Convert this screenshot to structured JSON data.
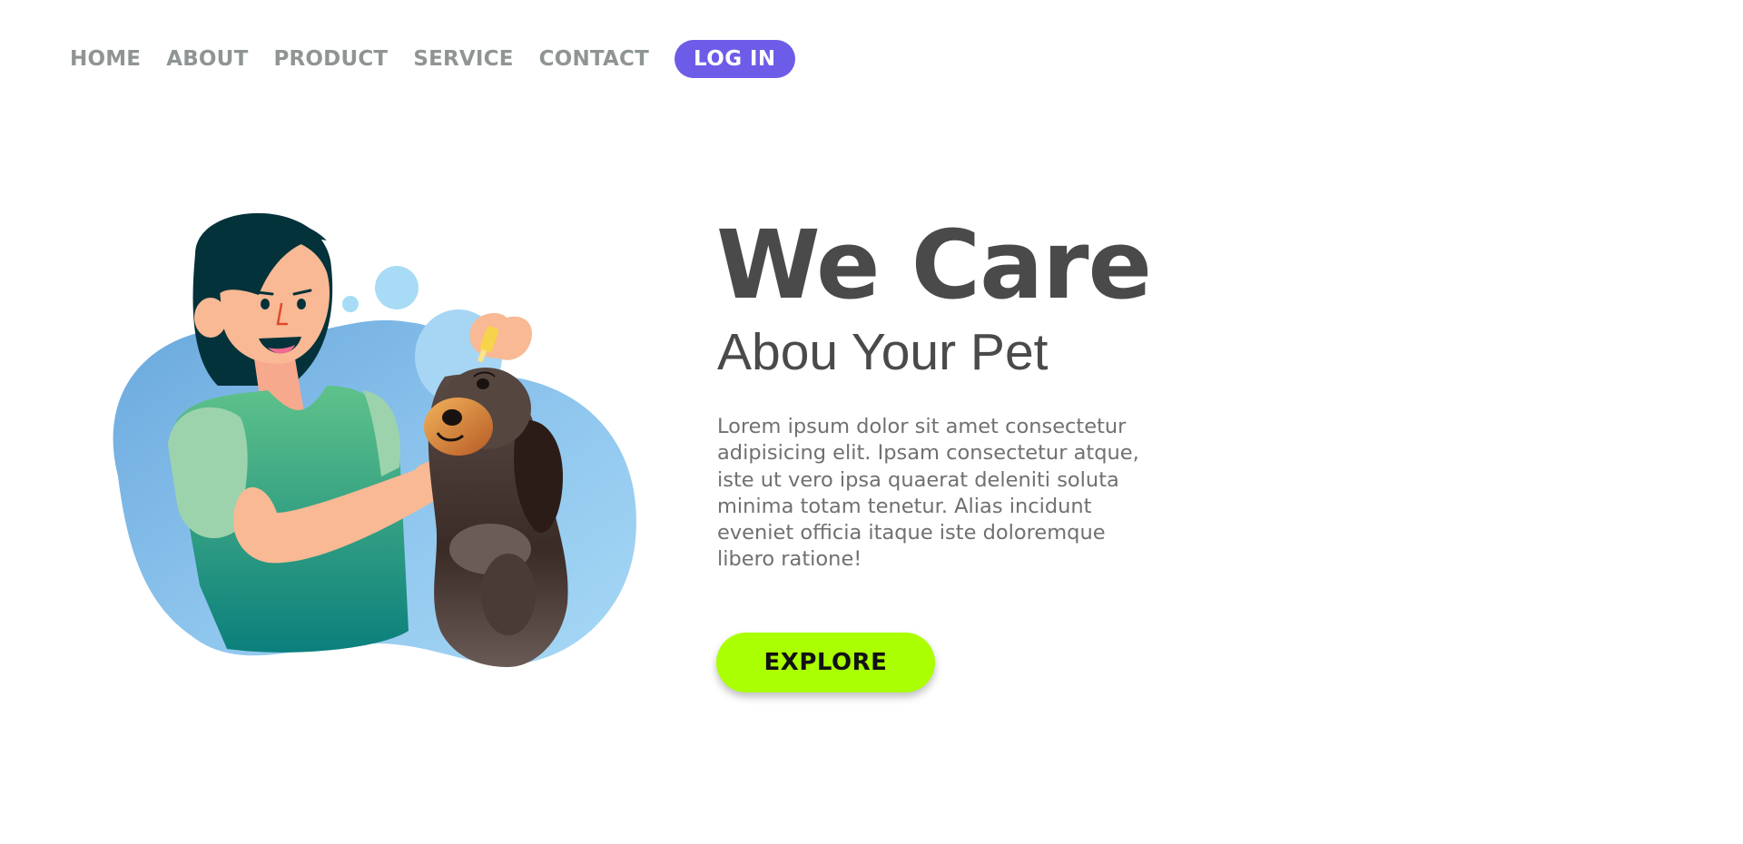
{
  "nav": {
    "items": [
      {
        "label": "HOME"
      },
      {
        "label": "ABOUT"
      },
      {
        "label": "PRODUCT"
      },
      {
        "label": "SERVICE"
      },
      {
        "label": "CONTACT"
      }
    ],
    "login_label": "LOG IN"
  },
  "hero": {
    "title": "We Care",
    "subtitle": "Abou Your Pet",
    "description": "Lorem ipsum dolor sit amet consectetur\nadipisicing elit. Ipsam consectetur atque,\niste ut vero ipsa quaerat deleniti soluta\nminima totam tenetur. Alias incidunt\neveniet officia itaque iste doloremque\nlibero ratione!",
    "cta_label": "EXPLORE"
  },
  "colors": {
    "login_bg": "#6c5ce7",
    "explore_bg": "#aaff00",
    "text_dark": "#4a4a4a",
    "nav_text": "#8f9494"
  },
  "icons": {
    "illustration": "woman-giving-dog-eye-drops-illustration"
  }
}
